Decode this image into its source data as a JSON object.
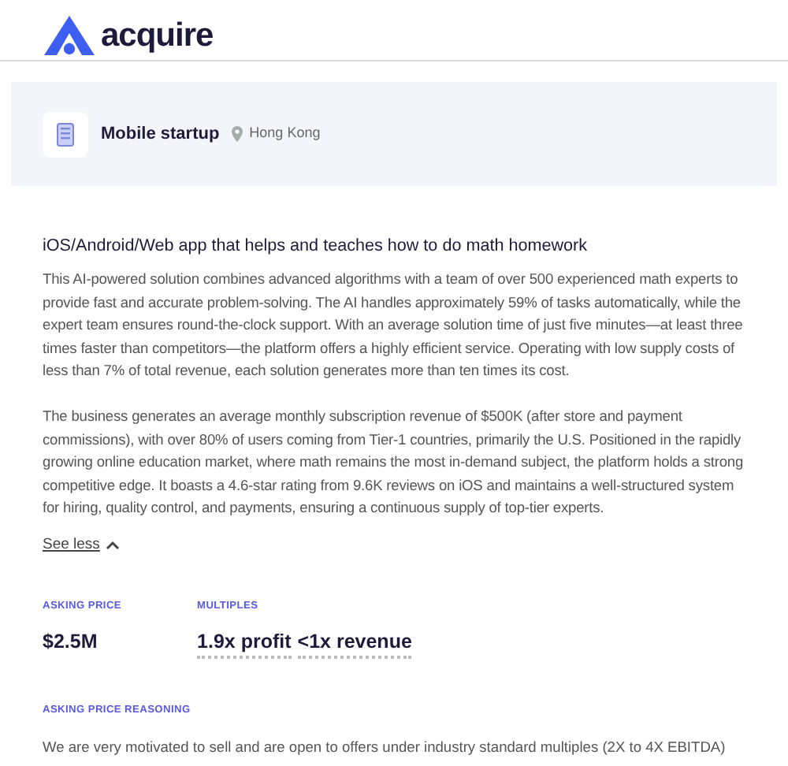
{
  "logo": {
    "text": "acquire"
  },
  "listing": {
    "category": "Mobile startup",
    "location": "Hong Kong"
  },
  "description": {
    "title": "iOS/Android/Web app that helps and teaches how to do math homework",
    "paragraphs": [
      "This AI-powered solution combines advanced algorithms with a team of over 500 experienced math experts to provide fast and accurate problem-solving. The AI handles approximately 59% of tasks automatically, while the expert team ensures round-the-clock support. With an average solution time of just five minutes—at least three times faster than competitors—the platform offers a highly efficient service. Operating with low supply costs of less than 7% of total revenue, each solution generates more than ten times its cost.",
      "The business generates an average monthly subscription revenue of $500K (after store and payment commissions), with over 80% of users coming from Tier-1 countries, primarily the U.S. Positioned in the rapidly growing online education market, where math remains the most in-demand subject, the platform holds a strong competitive edge. It boasts a 4.6-star rating from 9.6K reviews on iOS and maintains a well-structured system for hiring, quality control, and payments, ensuring a continuous supply of top-tier experts."
    ],
    "toggle": {
      "label": "See less",
      "expanded": true
    }
  },
  "asking_price": {
    "label": "ASKING PRICE",
    "value": "$2.5M"
  },
  "multiples": {
    "label": "MULTIPLES",
    "values": [
      "1.9x profit",
      "<1x revenue"
    ]
  },
  "reasoning": {
    "label": "ASKING PRICE REASONING",
    "text": "We are very motivated to sell and are open to offers under industry standard multiples (2X to 4X EBITDA)"
  }
}
